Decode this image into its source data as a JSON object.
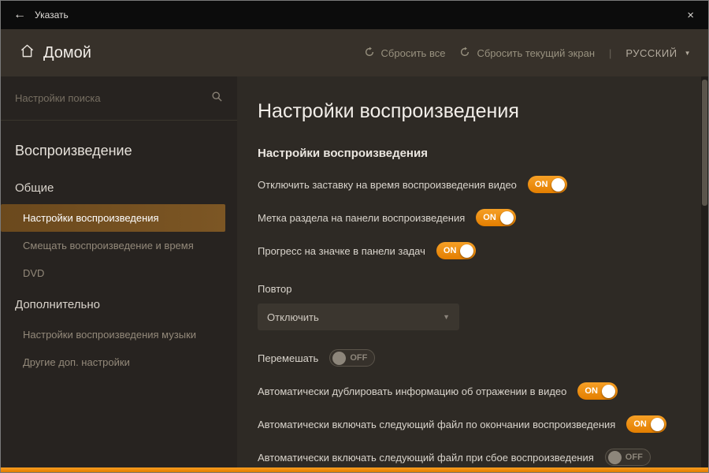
{
  "titlebar": {
    "back_label": "Указать",
    "back_icon": "←",
    "close_icon": "×"
  },
  "header": {
    "title": "Домой",
    "reset_all": "Сбросить все",
    "reset_screen": "Сбросить текущий экран",
    "separator": "|",
    "language": "РУССКИЙ",
    "caret_icon": "▼"
  },
  "sidebar": {
    "search_placeholder": "Настройки поиска",
    "section_title": "Воспроизведение",
    "groups": [
      {
        "label": "Общие",
        "items": [
          {
            "label": "Настройки воспроизведения",
            "selected": true
          },
          {
            "label": "Смещать воспроизведение и время",
            "selected": false
          },
          {
            "label": "DVD",
            "selected": false
          }
        ]
      },
      {
        "label": "Дополнительно",
        "items": [
          {
            "label": "Настройки воспроизведения музыки",
            "selected": false
          },
          {
            "label": "Другие доп. настройки",
            "selected": false
          }
        ]
      }
    ]
  },
  "content": {
    "title": "Настройки воспроизведения",
    "subtitle": "Настройки воспроизведения",
    "settings": [
      {
        "label": "Отключить заставку на время воспроизведения видео",
        "type": "toggle",
        "value": "ON"
      },
      {
        "label": "Метка раздела на панели воспроизведения",
        "type": "toggle",
        "value": "ON"
      },
      {
        "label": "Прогресс на значке в панели задач",
        "type": "toggle",
        "value": "ON"
      },
      {
        "label": "Повтор",
        "type": "dropdown",
        "value": "Отключить"
      },
      {
        "label": "Перемешать",
        "type": "toggle",
        "value": "OFF"
      },
      {
        "label": "Автоматически дублировать информацию об отражении в видео",
        "type": "toggle",
        "value": "ON"
      },
      {
        "label": "Автоматически включать следующий файл по окончании воспроизведения",
        "type": "toggle",
        "value": "ON"
      },
      {
        "label": "Автоматически включать следующий файл при сбое воспроизведения",
        "type": "toggle",
        "value": "OFF"
      }
    ]
  },
  "colors": {
    "accent": "#ef8a00",
    "toggle_off": "#8d867b",
    "selected_item_bg": "#6b491d"
  }
}
